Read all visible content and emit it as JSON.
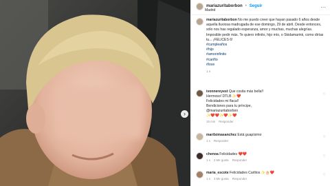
{
  "post": {
    "username": "mariazuritaborbon",
    "dot": "•",
    "follow": "Seguir",
    "more": "...",
    "location": "Madrid"
  },
  "caption": {
    "username": "mariazuritaborbon",
    "text": "No me puedo creer que hayan pasado 6 años desde aquella lluviosa madrugada de ese domingo, 29 de abril. Desde entonces, sólo nos has regalado esperanza, amor y muchas, muchas alegrías. Imposible pedir más. Te quiero infinito, hijo mío, o Skidamarink, como dirías tu... ¡FELICES 6!",
    "hashtags": [
      "#cumpleaños",
      "#hijo",
      "#amorinfinito",
      "#cariño",
      "#love"
    ],
    "time": "1 s"
  },
  "comments": [
    {
      "username": "ivonnereyest",
      "lines": [
        "Que cosita más bella!!",
        "Hermoso! DTLB ✨❤️",
        "Felicidades mi flaca!!",
        "Bendiciones para tu príncipe,",
        "@mariazuritaborbon",
        "✨❤️❤️✨❤️✨❤️"
      ],
      "time": "15 min",
      "reply": "Responder"
    },
    {
      "username": "marilsimasanchez",
      "text": "Está guapísimo",
      "time": "1 s",
      "reply": "Responder"
    },
    {
      "username": "chenoa",
      "text": "Felicidades ❤️❤️",
      "time": "1 s",
      "likes": "2 Me gusta",
      "reply": "Responder"
    },
    {
      "username": "maria_escote",
      "text": "Felicidades Carlitos ✨🎂❤️",
      "time": "1 s",
      "likes": "3 Me gusta",
      "reply": "Responder"
    }
  ],
  "icons": {
    "next": "chevron-right-icon",
    "heart": "heart-icon"
  }
}
